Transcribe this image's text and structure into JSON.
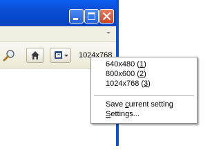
{
  "titlebar": {
    "minimize_icon": "minimize-icon",
    "maximize_icon": "maximize-icon",
    "close_icon": "close-icon"
  },
  "toolbar": {
    "search_icon": "search-icon",
    "home_icon": "home-icon",
    "extension_icon": "window-resizer-icon",
    "current_size": "1024x768"
  },
  "menu": {
    "items": [
      {
        "pre": "640x480 (",
        "key": "1",
        "post": ")"
      },
      {
        "pre": "800x600 (",
        "key": "2",
        "post": ")"
      },
      {
        "pre": "1024x768 (",
        "key": "3",
        "post": ")"
      }
    ],
    "save": {
      "pre": "Save ",
      "key": "c",
      "post": "urrent setting"
    },
    "settings": {
      "pre": "",
      "key": "S",
      "post": "ettings..."
    }
  },
  "colors": {
    "title_blue": "#0a4fd6",
    "close_red": "#d3401f",
    "toolbar_bg": "#ece9d8"
  }
}
